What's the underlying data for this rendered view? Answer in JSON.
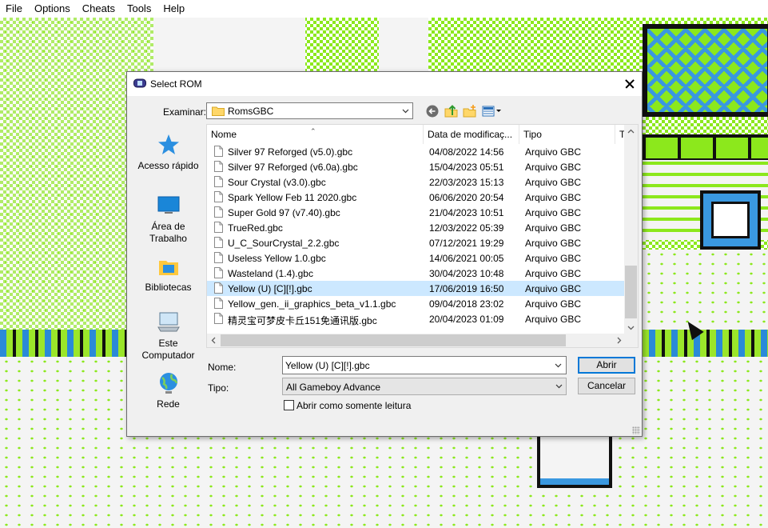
{
  "menu": [
    "File",
    "Options",
    "Cheats",
    "Tools",
    "Help"
  ],
  "dialog": {
    "title": "Select ROM",
    "look_in_label": "Examinar:",
    "look_in_value": "RomsGBC",
    "toolbar_icons": [
      "back-arrow-icon",
      "up-folder-icon",
      "new-folder-icon",
      "view-menu-icon"
    ],
    "places": [
      {
        "label": "Acesso rápido",
        "icon": "star-icon"
      },
      {
        "label": "Área de Trabalho",
        "icon": "desktop-icon"
      },
      {
        "label": "Bibliotecas",
        "icon": "libraries-icon"
      },
      {
        "label": "Este Computador",
        "icon": "computer-icon"
      },
      {
        "label": "Rede",
        "icon": "network-icon"
      }
    ],
    "columns": {
      "name": "Nome",
      "date": "Data de modificaç...",
      "type": "Tipo",
      "size": "T"
    },
    "files": [
      {
        "name": "Silver 97 Reforged (v5.0).gbc",
        "date": "04/08/2022 14:56",
        "type": "Arquivo GBC",
        "selected": false
      },
      {
        "name": "Silver 97 Reforged (v6.0a).gbc",
        "date": "15/04/2023 05:51",
        "type": "Arquivo GBC",
        "selected": false
      },
      {
        "name": "Sour Crystal (v3.0).gbc",
        "date": "22/03/2023 15:13",
        "type": "Arquivo GBC",
        "selected": false
      },
      {
        "name": "Spark Yellow Feb 11 2020.gbc",
        "date": "06/06/2020 20:54",
        "type": "Arquivo GBC",
        "selected": false
      },
      {
        "name": "Super Gold 97 (v7.40).gbc",
        "date": "21/04/2023 10:51",
        "type": "Arquivo GBC",
        "selected": false
      },
      {
        "name": "TrueRed.gbc",
        "date": "12/03/2022 05:39",
        "type": "Arquivo GBC",
        "selected": false
      },
      {
        "name": "U_C_SourCrystal_2.2.gbc",
        "date": "07/12/2021 19:29",
        "type": "Arquivo GBC",
        "selected": false
      },
      {
        "name": "Useless Yellow 1.0.gbc",
        "date": "14/06/2021 00:05",
        "type": "Arquivo GBC",
        "selected": false
      },
      {
        "name": "Wasteland (1.4).gbc",
        "date": "30/04/2023 10:48",
        "type": "Arquivo GBC",
        "selected": false
      },
      {
        "name": "Yellow (U) [C][!].gbc",
        "date": "17/06/2019 16:50",
        "type": "Arquivo GBC",
        "selected": true
      },
      {
        "name": "Yellow_gen._ii_graphics_beta_v1.1.gbc",
        "date": "09/04/2018 23:02",
        "type": "Arquivo GBC",
        "selected": false
      },
      {
        "name": "精灵宝可梦皮卡丘151免通讯版.gbc",
        "date": "20/04/2023 01:09",
        "type": "Arquivo GBC",
        "selected": false
      }
    ],
    "name_label": "Nome:",
    "name_value": "Yellow (U) [C][!].gbc",
    "type_label": "Tipo:",
    "type_value": "All Gameboy Advance",
    "open_button": "Abrir",
    "cancel_button": "Cancelar",
    "readonly_label": "Abrir como somente leitura",
    "readonly_checked": false
  },
  "colors": {
    "selection": "#cce8ff",
    "accent_border": "#0078d7",
    "game_green": "#8ce81c",
    "game_blue": "#3a98e0"
  }
}
